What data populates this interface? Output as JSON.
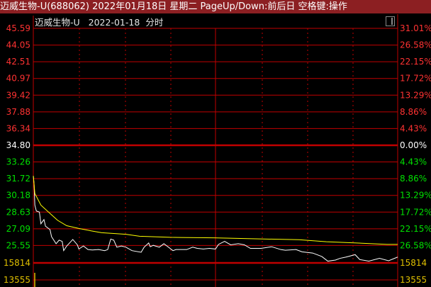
{
  "title_bar": {
    "text": "迈威生物-U(688062) 2022年01月18日 星期二 PageUp/Down:前后日 空格键:操作"
  },
  "chart_header": {
    "name": "迈威生物-U",
    "date": "2022-01-18",
    "mode": "分时"
  },
  "colors": {
    "up": "#ff3232",
    "down": "#00e000",
    "flat": "#ffffff",
    "volume": "#e0c000",
    "grid": "#c00000",
    "price_line": "#ffffff",
    "avg_line": "#ffff00",
    "title_bg": "#8c1f22"
  },
  "left_axis": [
    "45.59",
    "44.05",
    "42.51",
    "40.97",
    "39.42",
    "37.88",
    "36.34",
    "34.80",
    "33.26",
    "31.72",
    "30.18",
    "28.63",
    "27.09",
    "25.55",
    "15814",
    "13555"
  ],
  "right_axis": [
    "31.01%",
    "26.58%",
    "22.15%",
    "17.72%",
    "13.29%",
    "8.86%",
    "4.43%",
    "0.00%",
    "4.43%",
    "8.86%",
    "13.29%",
    "17.72%",
    "22.15%",
    "26.58%",
    "15814",
    "13555"
  ],
  "axis_kind": [
    "up",
    "up",
    "up",
    "up",
    "up",
    "up",
    "up",
    "flat",
    "down",
    "down",
    "down",
    "down",
    "down",
    "down",
    "volume",
    "volume"
  ],
  "chart_data": {
    "type": "line",
    "x_range_minutes": [
      0,
      240
    ],
    "y_range": [
      25.55,
      45.59
    ],
    "prev_close": 34.8,
    "series": [
      {
        "key": "price",
        "points": [
          [
            0,
            31.98
          ],
          [
            0.5,
            31.22
          ],
          [
            1,
            29.28
          ],
          [
            2,
            28.74
          ],
          [
            4,
            28.64
          ],
          [
            5,
            27.56
          ],
          [
            7,
            27.95
          ],
          [
            8,
            27.34
          ],
          [
            11,
            27.02
          ],
          [
            12,
            26.37
          ],
          [
            15,
            25.72
          ],
          [
            17,
            26.05
          ],
          [
            19,
            25.94
          ],
          [
            20,
            25.08
          ],
          [
            22,
            25.51
          ],
          [
            26,
            26.11
          ],
          [
            29,
            25.62
          ],
          [
            30,
            25.23
          ],
          [
            33,
            25.51
          ],
          [
            36,
            25.18
          ],
          [
            39,
            25.14
          ],
          [
            43,
            25.18
          ],
          [
            47,
            25.08
          ],
          [
            49,
            25.18
          ],
          [
            51,
            26.15
          ],
          [
            53,
            26.05
          ],
          [
            55,
            25.4
          ],
          [
            58,
            25.51
          ],
          [
            61,
            25.4
          ],
          [
            65,
            25.08
          ],
          [
            71,
            24.93
          ],
          [
            73,
            25.4
          ],
          [
            76,
            25.79
          ],
          [
            77,
            25.44
          ],
          [
            79,
            25.57
          ],
          [
            83,
            25.4
          ],
          [
            86,
            25.72
          ],
          [
            88,
            25.51
          ],
          [
            92,
            25.08
          ],
          [
            94,
            25.18
          ],
          [
            101,
            25.18
          ],
          [
            105,
            25.4
          ],
          [
            108,
            25.29
          ],
          [
            112,
            25.23
          ],
          [
            116,
            25.29
          ],
          [
            120,
            25.23
          ],
          [
            122,
            25.66
          ],
          [
            126,
            25.94
          ],
          [
            130,
            25.62
          ],
          [
            135,
            25.72
          ],
          [
            139,
            25.62
          ],
          [
            143,
            25.29
          ],
          [
            150,
            25.29
          ],
          [
            157,
            25.44
          ],
          [
            163,
            25.18
          ],
          [
            166,
            25.12
          ],
          [
            173,
            25.18
          ],
          [
            177,
            24.97
          ],
          [
            184,
            24.86
          ],
          [
            190,
            24.54
          ],
          [
            194,
            24.11
          ],
          [
            199,
            24.21
          ],
          [
            202,
            24.37
          ],
          [
            206,
            24.49
          ],
          [
            212,
            24.71
          ],
          [
            215,
            24.26
          ],
          [
            221,
            24.11
          ],
          [
            228,
            24.37
          ],
          [
            234,
            24.15
          ],
          [
            240,
            24.49
          ]
        ]
      },
      {
        "key": "average",
        "points": [
          [
            0,
            31.98
          ],
          [
            1,
            30.36
          ],
          [
            5,
            29.28
          ],
          [
            10,
            28.64
          ],
          [
            16,
            27.88
          ],
          [
            22,
            27.38
          ],
          [
            30,
            27.13
          ],
          [
            38,
            26.91
          ],
          [
            45,
            26.74
          ],
          [
            61,
            26.59
          ],
          [
            70,
            26.41
          ],
          [
            90,
            26.31
          ],
          [
            119,
            26.26
          ],
          [
            154,
            26.15
          ],
          [
            175,
            26.09
          ],
          [
            193,
            25.9
          ],
          [
            213,
            25.79
          ],
          [
            233,
            25.66
          ],
          [
            240,
            25.66
          ]
        ]
      }
    ]
  }
}
